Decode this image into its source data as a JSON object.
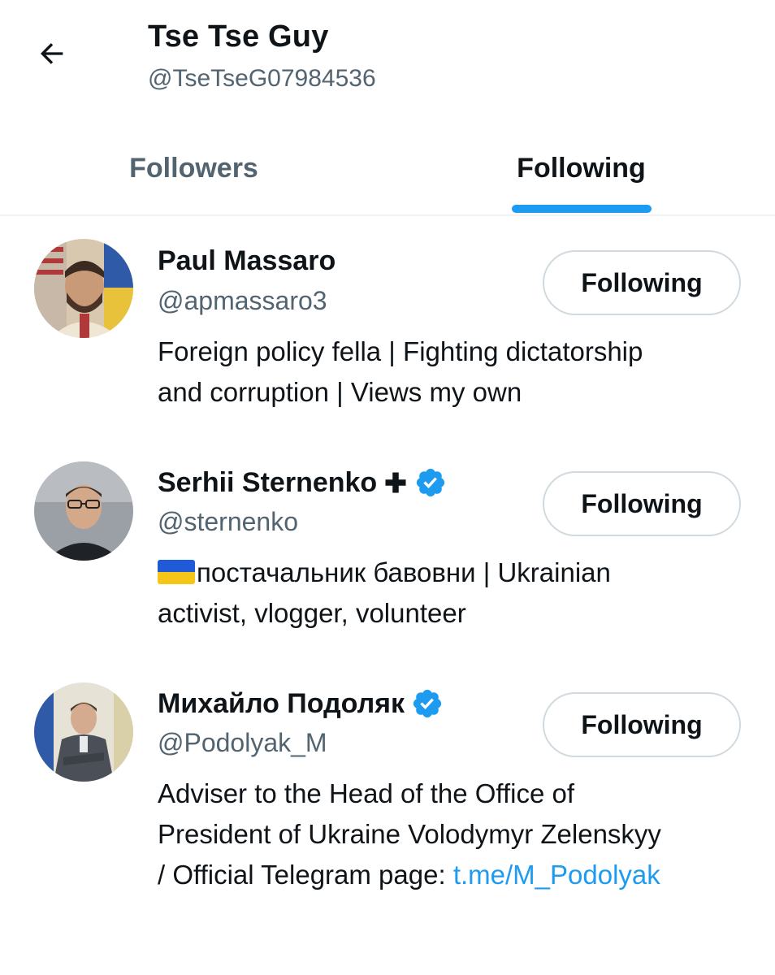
{
  "header": {
    "title": "Tse Tse Guy",
    "handle": "@TseTseG07984536"
  },
  "tabs": [
    {
      "label": "Followers",
      "active": false
    },
    {
      "label": "Following",
      "active": true
    }
  ],
  "colors": {
    "accent": "#1d9bf0",
    "secondary_text": "#536471",
    "primary_text": "#0f1419",
    "border": "#cfd9de"
  },
  "users": [
    {
      "name": "Paul Massaro",
      "handle": "@apmassaro3",
      "button": "Following",
      "verified": false,
      "bio_line1": "Foreign policy fella | Fighting dictatorship",
      "bio_line2": "and corruption | Views my own",
      "avatar_icon": "avatar-paul-massaro"
    },
    {
      "name": "Serhii Sternenko",
      "handle": "@sternenko",
      "button": "Following",
      "verified": true,
      "name_badge_icon": "cross-icon",
      "bio_flag_icon": "ukraine-flag-icon",
      "bio_line1": "постачальник бавовни | Ukrainian",
      "bio_line2": "activist, vlogger, volunteer",
      "avatar_icon": "avatar-serhii-sternenko"
    },
    {
      "name": "Михайло Подоляк",
      "handle": "@Podolyak_M",
      "button": "Following",
      "verified": true,
      "bio_line1": "Adviser to the Head of the Office of",
      "bio_line2": "President of Ukraine Volodymyr Zelenskyy",
      "bio_line3": "/ Official Telegram page: ",
      "bio_link": "t.me/M_Podolyak",
      "avatar_icon": "avatar-mykhailo-podolyak"
    }
  ]
}
